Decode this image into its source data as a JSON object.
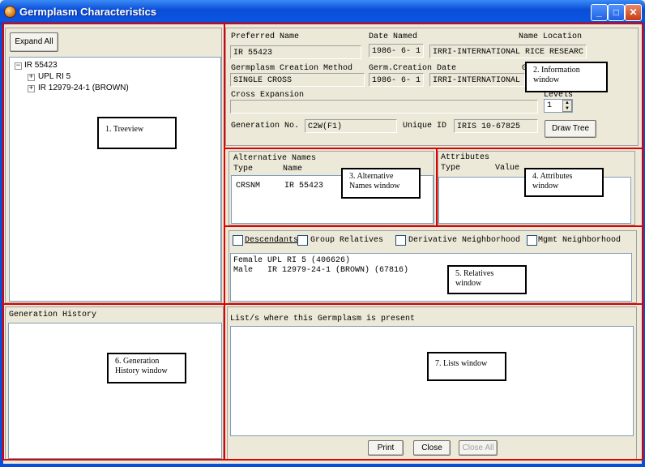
{
  "window": {
    "title": "Germplasm Characteristics",
    "minimize": "_",
    "maximize": "□",
    "close": "✕"
  },
  "treeview": {
    "expand_all": "Expand All",
    "nodes": [
      {
        "label": "IR 55423",
        "expander": "−"
      },
      {
        "label": "UPL RI 5",
        "expander": "+"
      },
      {
        "label": "IR 12979-24-1 (BROWN)",
        "expander": "+"
      }
    ]
  },
  "info": {
    "preferred_name_label": "Preferred Name",
    "preferred_name": "IR 55423",
    "date_named_label": "Date Named",
    "date_named": "1986- 6- 1",
    "name_location_label": "Name Location",
    "name_location": "IRRI-INTERNATIONAL RICE RESEARC",
    "creation_method_label": "Germplasm Creation Method",
    "creation_method": "SINGLE CROSS",
    "creation_date_label": "Germ.Creation Date",
    "creation_date": "1986- 6- 1",
    "creation_location_label": "G",
    "creation_location": "IRRI-INTERNATIONAL",
    "cross_expansion_label": "Cross Expansion",
    "cross_expansion": "",
    "levels_label": "Levels",
    "levels": "1",
    "generation_no_label": "Generation No.",
    "generation_no": "C2W(F1)",
    "unique_id_label": "Unique ID",
    "unique_id": "IRIS 10-67825",
    "draw_tree": "Draw Tree"
  },
  "alt_names": {
    "title": "Alternative Names",
    "col_type": "Type",
    "col_name": "Name",
    "rows": [
      {
        "type": "CRSNM",
        "name": "IR 55423"
      }
    ]
  },
  "attributes": {
    "title": "Attributes",
    "col_type": "Type",
    "col_value": "Value"
  },
  "relatives": {
    "options": [
      {
        "label": "Descendants"
      },
      {
        "label": "Group Relatives"
      },
      {
        "label": "Derivative Neighborhood"
      },
      {
        "label": "Mgmt Neighborhood"
      }
    ],
    "lines": [
      "Female UPL RI 5 (406626)",
      "Male   IR 12979-24-1 (BROWN) (67816)"
    ]
  },
  "generation_history": {
    "title": "Generation History"
  },
  "lists": {
    "title": "List/s where this Germplasm is present",
    "print": "Print",
    "close": "Close",
    "close_all": "Close All"
  },
  "callouts": {
    "c1": "1. Treeview",
    "c2a": "2. Information",
    "c2b": "window",
    "c3a": "3. Alternative",
    "c3b": "Names window",
    "c4a": "4. Attributes",
    "c4b": "window",
    "c5a": "5. Relatives",
    "c5b": "window",
    "c6a": "6. Generation",
    "c6b": "History window",
    "c7": "7. Lists window"
  }
}
